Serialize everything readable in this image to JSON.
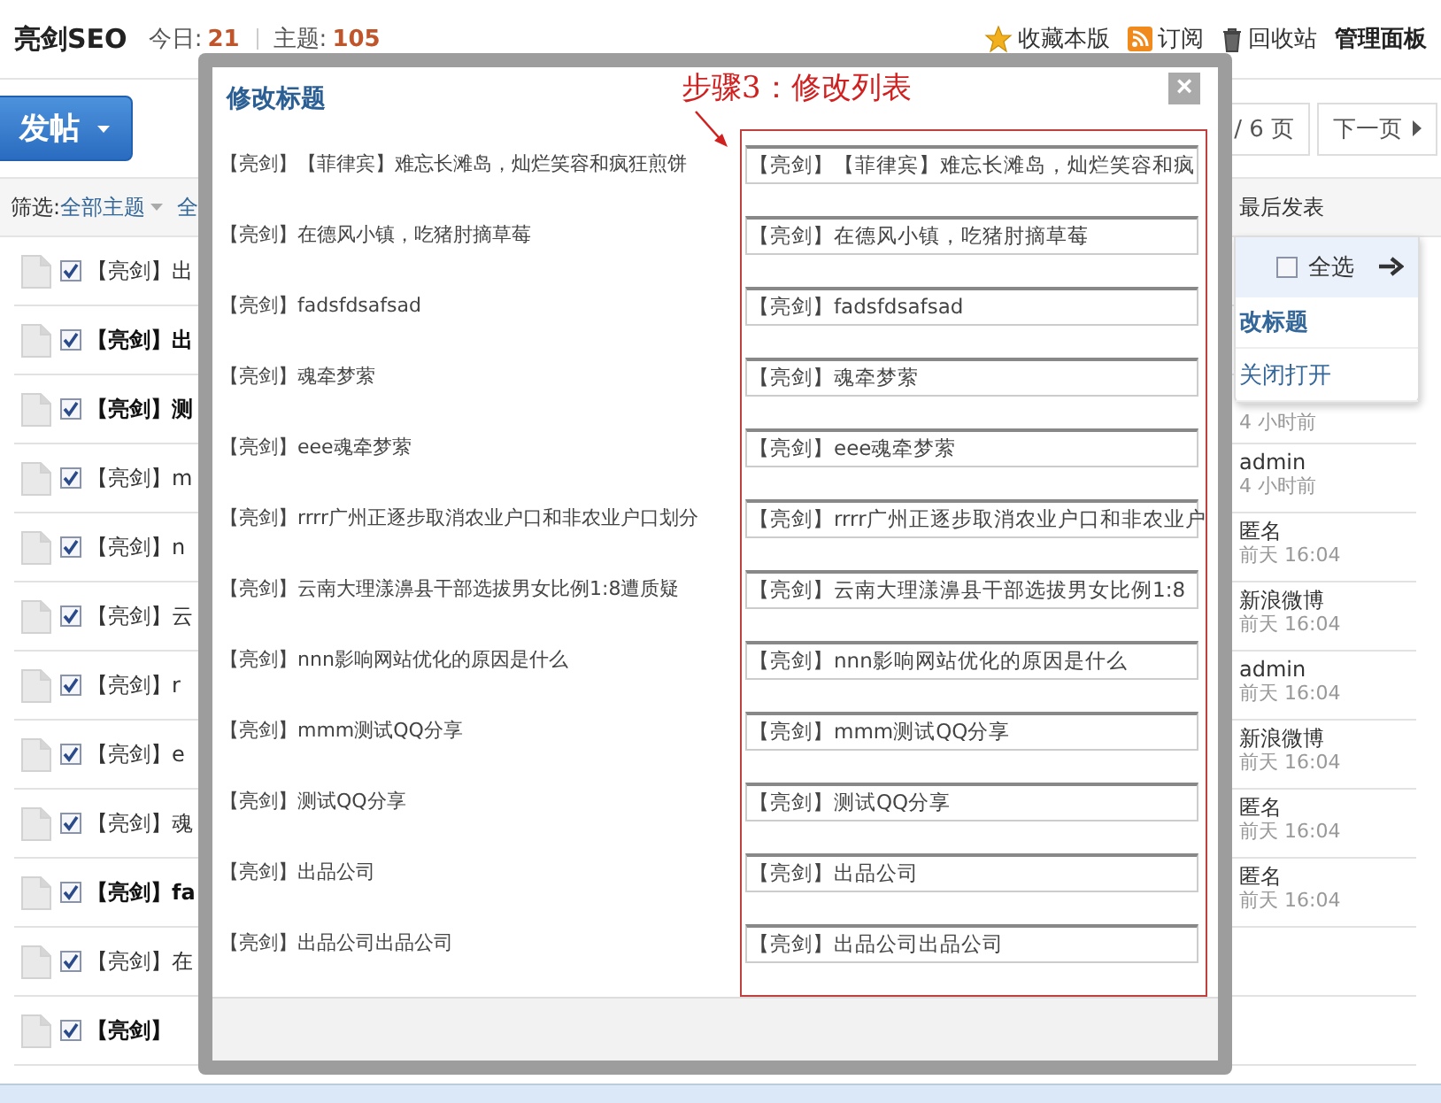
{
  "header": {
    "forum_name": "亮剑SEO",
    "today_label": "今日:",
    "today_count": "21",
    "threads_label": "主题:",
    "threads_count": "105",
    "links": [
      {
        "kind": "star",
        "label": "收藏本版"
      },
      {
        "kind": "rss",
        "label": "订阅"
      },
      {
        "kind": "trash",
        "label": "回收站"
      },
      {
        "kind": "plain",
        "label": "管理面板"
      }
    ]
  },
  "post_button": "发帖",
  "pager": {
    "total": "/ 6 页",
    "next": "下一页"
  },
  "filter": {
    "label": "筛选:",
    "current": "全部主题",
    "next": "全",
    "last_post": "最后发表"
  },
  "threads": [
    {
      "title": "【亮剑】出",
      "bold": false,
      "checked": true
    },
    {
      "title": "【亮剑】出",
      "bold": true,
      "checked": true
    },
    {
      "title": "【亮剑】测",
      "bold": true,
      "checked": true,
      "time": "4 小时前"
    },
    {
      "title": "【亮剑】m",
      "bold": false,
      "checked": true,
      "author": "admin",
      "time": "4 小时前"
    },
    {
      "title": "【亮剑】n",
      "bold": false,
      "checked": true,
      "author": "匿名",
      "time": "前天 16:04"
    },
    {
      "title": "【亮剑】云",
      "bold": false,
      "checked": true,
      "author": "新浪微博",
      "time": "前天 16:04"
    },
    {
      "title": "【亮剑】r",
      "bold": false,
      "checked": true,
      "author": "admin",
      "time": "前天 16:04"
    },
    {
      "title": "【亮剑】e",
      "bold": false,
      "checked": true,
      "author": "新浪微博",
      "time": "前天 16:04"
    },
    {
      "title": "【亮剑】魂",
      "bold": false,
      "checked": true,
      "author": "匿名",
      "time": "前天 16:04"
    },
    {
      "title": "【亮剑】fa",
      "bold": true,
      "checked": true,
      "author": "匿名",
      "time": "前天 16:04"
    },
    {
      "title": "【亮剑】在",
      "bold": false,
      "checked": true
    },
    {
      "title": "【亮剑】",
      "bold": true,
      "checked": true
    }
  ],
  "menu": {
    "select_all": {
      "label": "全选",
      "checked": false
    },
    "items": [
      {
        "label": "改标题",
        "bold": true
      },
      {
        "label": "关闭打开",
        "bold": false
      }
    ]
  },
  "dialog": {
    "title": "修改标题",
    "close": "×",
    "annotation": "步骤3：修改列表",
    "rows": [
      {
        "original": "【亮剑】【菲律宾】难忘长滩岛，灿烂笑容和疯狂煎饼",
        "value": "【亮剑】【菲律宾】难忘长滩岛，灿烂笑容和疯"
      },
      {
        "original": "【亮剑】在德风小镇，吃猪肘摘草莓",
        "value": "【亮剑】在德风小镇，吃猪肘摘草莓"
      },
      {
        "original": "【亮剑】fadsfdsafsad",
        "value": "【亮剑】fadsfdsafsad"
      },
      {
        "original": "【亮剑】魂牵梦萦",
        "value": "【亮剑】魂牵梦萦"
      },
      {
        "original": "【亮剑】eee魂牵梦萦",
        "value": "【亮剑】eee魂牵梦萦"
      },
      {
        "original": "【亮剑】rrrr广州正逐步取消农业户口和非农业户口划分",
        "value": "【亮剑】rrrr广州正逐步取消农业户口和非农业户"
      },
      {
        "original": "【亮剑】云南大理漾濞县干部选拔男女比例1:8遭质疑",
        "value": "【亮剑】云南大理漾濞县干部选拔男女比例1:8"
      },
      {
        "original": "【亮剑】nnn影响网站优化的原因是什么",
        "value": "【亮剑】nnn影响网站优化的原因是什么"
      },
      {
        "original": "【亮剑】mmm测试QQ分享",
        "value": "【亮剑】mmm测试QQ分享"
      },
      {
        "original": "【亮剑】测试QQ分享",
        "value": "【亮剑】测试QQ分享"
      },
      {
        "original": "【亮剑】出品公司",
        "value": "【亮剑】出品公司"
      },
      {
        "original": "【亮剑】出品公司出品公司",
        "value": "【亮剑】出品公司出品公司"
      }
    ]
  }
}
